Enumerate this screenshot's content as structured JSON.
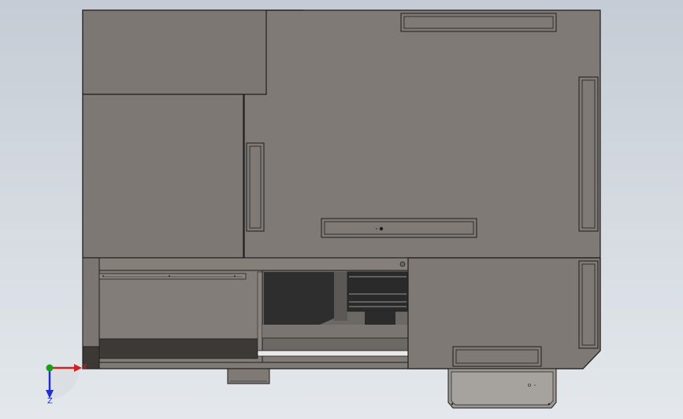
{
  "viewport": {
    "background_top": "#c5ccd5",
    "background_bottom": "#e4e8ec",
    "body_color": "#7f7a75",
    "edge_color": "#1e1e1e"
  },
  "triad": {
    "x_label": "X",
    "z_label": "Z",
    "x_color": "#d42020",
    "y_color": "#18a018",
    "z_color": "#2030c8"
  }
}
